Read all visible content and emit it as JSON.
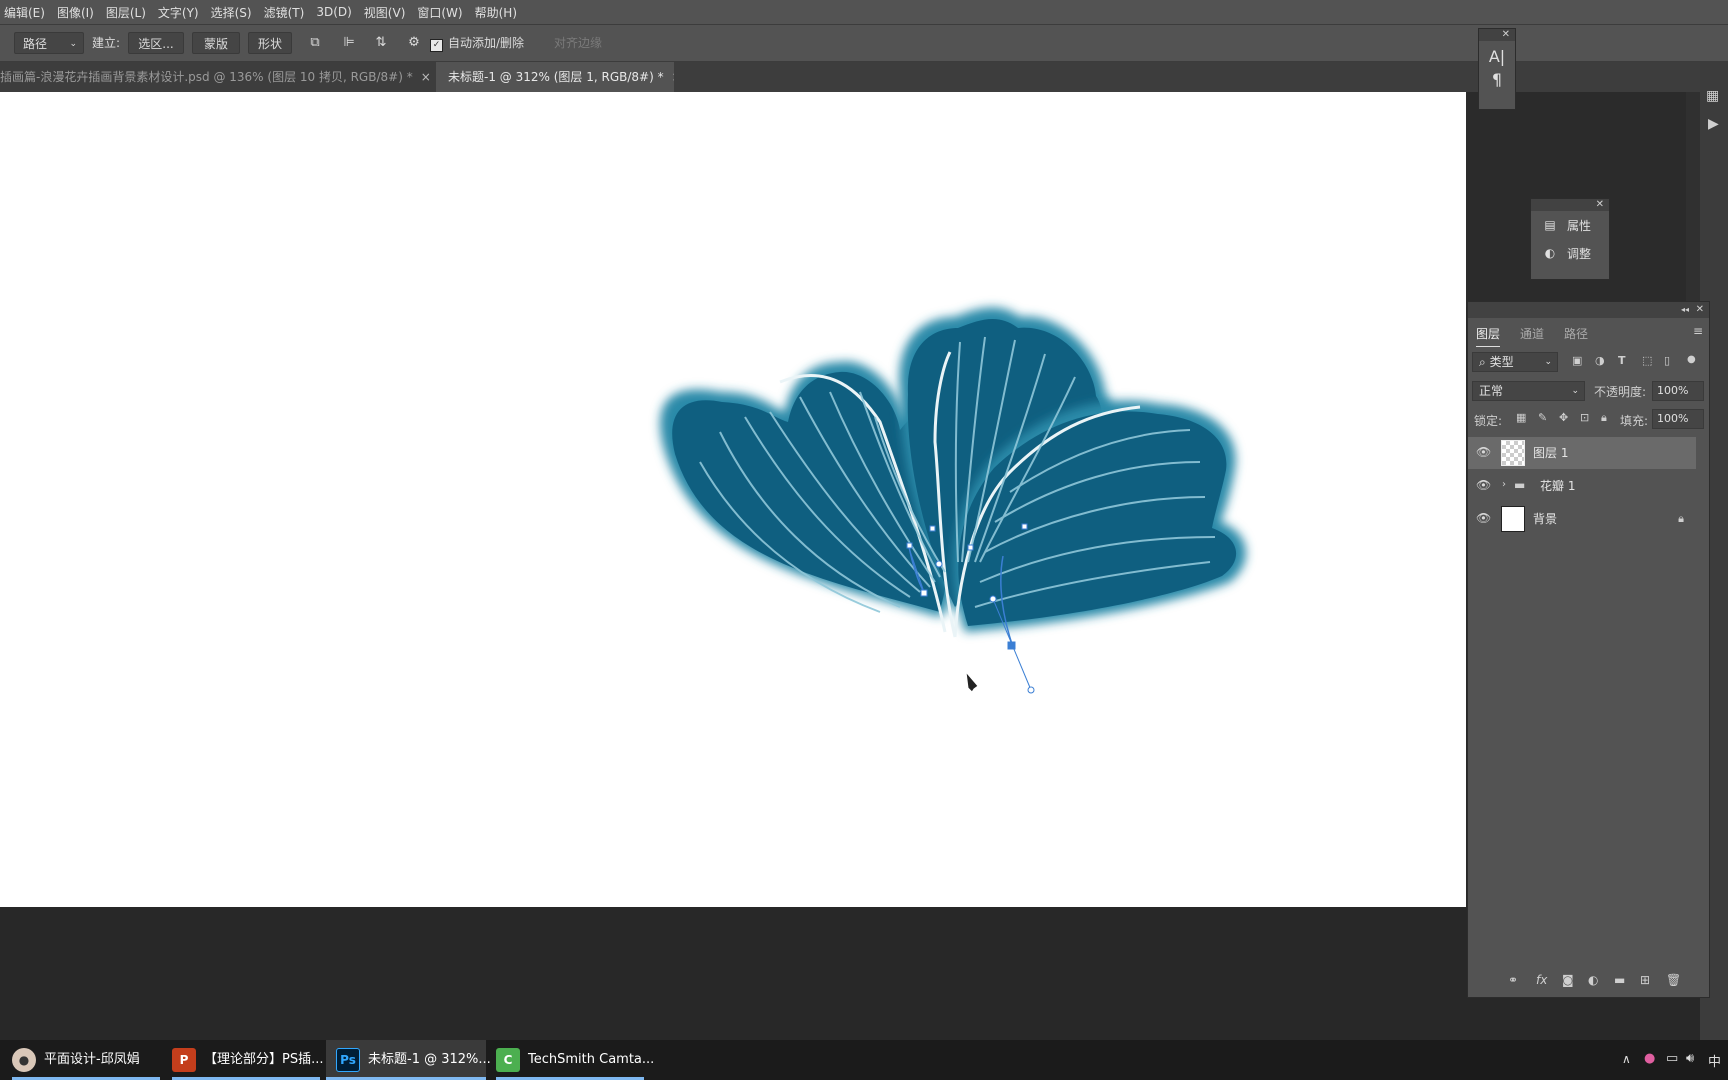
{
  "menu": [
    "编辑(E)",
    "图像(I)",
    "图层(L)",
    "文字(Y)",
    "选择(S)",
    "滤镜(T)",
    "3D(D)",
    "视图(V)",
    "窗口(W)",
    "帮助(H)"
  ],
  "options": {
    "path_mode": "路径",
    "make_label": "建立:",
    "selection_btn": "选区...",
    "mask_btn": "蒙版",
    "shape_btn": "形状",
    "auto_add_delete": "自动添加/删除",
    "align_edges": "对齐边缘"
  },
  "tabs": [
    {
      "label": "插画篇-浪漫花卉插画背景素材设计.psd @ 136% (图层 10 拷贝, RGB/8#) *",
      "active": false
    },
    {
      "label": "未标题-1 @ 312% (图层 1, RGB/8#) *",
      "active": true
    }
  ],
  "char_panel": {
    "items": [
      "A|",
      "¶"
    ]
  },
  "props_panel": {
    "items": [
      "属性",
      "调整"
    ]
  },
  "layers_panel": {
    "tabs": [
      "图层",
      "通道",
      "路径"
    ],
    "filter_kind": "类型",
    "blend_mode": "正常",
    "opacity_label": "不透明度:",
    "opacity_value": "100%",
    "lock_label": "锁定:",
    "fill_label": "填充:",
    "fill_value": "100%",
    "layers": [
      {
        "name": "图层 1",
        "selected": true,
        "type": "pixel"
      },
      {
        "name": "花瓣 1",
        "selected": false,
        "type": "group"
      },
      {
        "name": "背景",
        "selected": false,
        "type": "background",
        "locked": true
      }
    ]
  },
  "taskbar": [
    {
      "label": "平面设计-邱凤娟"
    },
    {
      "label": "【理论部分】PS插..."
    },
    {
      "label": "未标题-1 @ 312%..."
    },
    {
      "label": "TechSmith Camta..."
    }
  ],
  "tray": {
    "ime": "中"
  },
  "colors": {
    "petal": "#1a6e8e",
    "petal_dark": "#0f5f80",
    "path": "#3b7fd4",
    "panel": "#535353"
  }
}
